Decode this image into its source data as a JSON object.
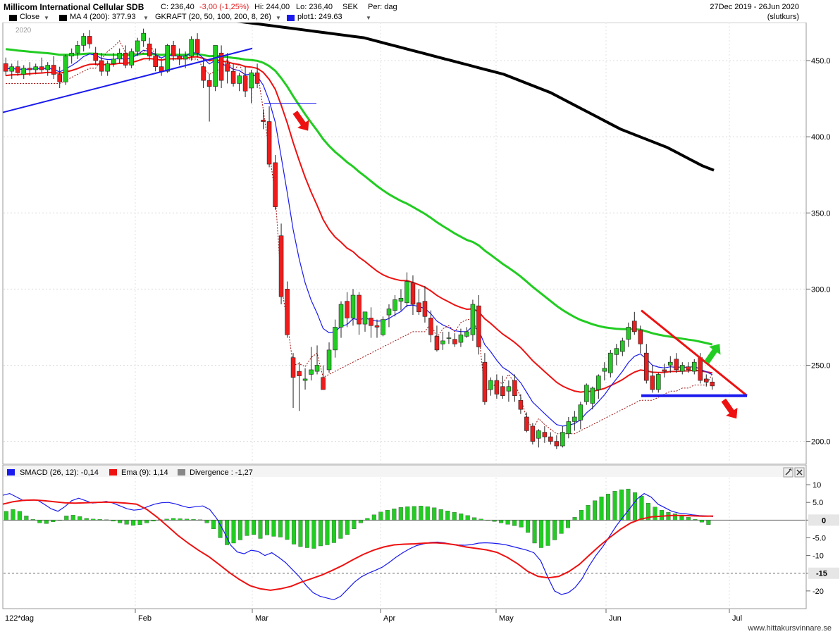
{
  "header": {
    "instrument": "Millicom International Cellular SDB",
    "close_label": "C: 236,40",
    "change": "-3,00 (-1,25%)",
    "hi": "Hi: 244,00",
    "lo": "Lo: 236,40",
    "currency": "SEK",
    "period": "Per: dag",
    "date_range": "27Dec 2019 - 26Jun 2020",
    "price_type": "(slutkurs)",
    "year_label": "2020"
  },
  "legend": {
    "close": "Close",
    "ma": "MA 4 (200): 377.93",
    "gkraft": "GKRAFT (20, 50, 100, 200, 8, 26)",
    "plot1": "plot1: 249.63"
  },
  "indicator_legend": {
    "smacd": "SMACD (26, 12): -0,14",
    "ema": "Ema (9): 1,14",
    "divergence": "Divergence : -1,27"
  },
  "footer": {
    "period_label": "122*dag",
    "watermark": "www.hittakursvinnare.se"
  },
  "colors": {
    "up": "#22cc22",
    "down": "#ee1c1c",
    "ma200": "#000000",
    "ma100": "#22cc22",
    "ma50": "#ee1111",
    "ma20": "#1a1aee",
    "macd": "#1a1aee",
    "signal": "#ee1111",
    "hist": "#22cc22"
  },
  "chart_data": [
    {
      "type": "candlestick",
      "title": "Millicom International Cellular SDB",
      "ylim": [
        185,
        475
      ],
      "y_ticks": [
        "450.0",
        "400.0",
        "350.0",
        "300.0",
        "250.0",
        "200.0"
      ],
      "x_ticks": [
        "Feb",
        "Mar",
        "Apr",
        "May",
        "Jun",
        "Jul"
      ],
      "current_value_label": "",
      "candles": [
        {
          "o": 448,
          "h": 452,
          "l": 440,
          "c": 443
        },
        {
          "o": 443,
          "h": 448,
          "l": 438,
          "c": 446
        },
        {
          "o": 446,
          "h": 450,
          "l": 440,
          "c": 442
        },
        {
          "o": 441,
          "h": 447,
          "l": 438,
          "c": 445
        },
        {
          "o": 445,
          "h": 449,
          "l": 440,
          "c": 444
        },
        {
          "o": 444,
          "h": 448,
          "l": 441,
          "c": 446
        },
        {
          "o": 446,
          "h": 452,
          "l": 442,
          "c": 444
        },
        {
          "o": 444,
          "h": 449,
          "l": 440,
          "c": 447
        },
        {
          "o": 447,
          "h": 453,
          "l": 438,
          "c": 441
        },
        {
          "o": 441,
          "h": 446,
          "l": 432,
          "c": 436
        },
        {
          "o": 436,
          "h": 454,
          "l": 434,
          "c": 453
        },
        {
          "o": 453,
          "h": 458,
          "l": 448,
          "c": 455
        },
        {
          "o": 455,
          "h": 463,
          "l": 451,
          "c": 460
        },
        {
          "o": 460,
          "h": 468,
          "l": 456,
          "c": 466
        },
        {
          "o": 466,
          "h": 470,
          "l": 458,
          "c": 461
        },
        {
          "o": 455,
          "h": 459,
          "l": 447,
          "c": 450
        },
        {
          "o": 450,
          "h": 455,
          "l": 440,
          "c": 443
        },
        {
          "o": 443,
          "h": 450,
          "l": 440,
          "c": 448
        },
        {
          "o": 448,
          "h": 455,
          "l": 446,
          "c": 451
        },
        {
          "o": 451,
          "h": 458,
          "l": 448,
          "c": 455
        },
        {
          "o": 455,
          "h": 460,
          "l": 445,
          "c": 447
        },
        {
          "o": 447,
          "h": 458,
          "l": 445,
          "c": 456
        },
        {
          "o": 456,
          "h": 465,
          "l": 453,
          "c": 463
        },
        {
          "o": 463,
          "h": 471,
          "l": 459,
          "c": 468
        },
        {
          "o": 461,
          "h": 465,
          "l": 450,
          "c": 453
        },
        {
          "o": 453,
          "h": 458,
          "l": 443,
          "c": 446
        },
        {
          "o": 446,
          "h": 450,
          "l": 440,
          "c": 443
        },
        {
          "o": 443,
          "h": 461,
          "l": 442,
          "c": 460
        },
        {
          "o": 460,
          "h": 463,
          "l": 450,
          "c": 453
        },
        {
          "o": 453,
          "h": 458,
          "l": 447,
          "c": 451
        },
        {
          "o": 451,
          "h": 456,
          "l": 445,
          "c": 453
        },
        {
          "o": 453,
          "h": 466,
          "l": 450,
          "c": 464
        },
        {
          "o": 464,
          "h": 468,
          "l": 452,
          "c": 455
        },
        {
          "o": 446,
          "h": 452,
          "l": 432,
          "c": 437
        },
        {
          "o": 437,
          "h": 441,
          "l": 410,
          "c": 433
        },
        {
          "o": 433,
          "h": 452,
          "l": 430,
          "c": 460
        },
        {
          "o": 455,
          "h": 460,
          "l": 432,
          "c": 437
        },
        {
          "o": 448,
          "h": 455,
          "l": 435,
          "c": 443
        },
        {
          "o": 443,
          "h": 448,
          "l": 433,
          "c": 435
        },
        {
          "o": 435,
          "h": 442,
          "l": 430,
          "c": 440
        },
        {
          "o": 440,
          "h": 446,
          "l": 426,
          "c": 430
        },
        {
          "o": 432,
          "h": 444,
          "l": 422,
          "c": 442
        },
        {
          "o": 442,
          "h": 448,
          "l": 432,
          "c": 435
        },
        {
          "o": 411,
          "h": 418,
          "l": 405,
          "c": 410
        },
        {
          "o": 410,
          "h": 420,
          "l": 380,
          "c": 382
        },
        {
          "o": 383,
          "h": 388,
          "l": 352,
          "c": 354
        },
        {
          "o": 335,
          "h": 343,
          "l": 290,
          "c": 295
        },
        {
          "o": 300,
          "h": 305,
          "l": 268,
          "c": 270
        },
        {
          "o": 255,
          "h": 258,
          "l": 222,
          "c": 242
        },
        {
          "o": 246,
          "h": 252,
          "l": 220,
          "c": 243
        },
        {
          "o": 240,
          "h": 248,
          "l": 234,
          "c": 241
        },
        {
          "o": 244,
          "h": 262,
          "l": 240,
          "c": 247
        },
        {
          "o": 246,
          "h": 263,
          "l": 244,
          "c": 250
        },
        {
          "o": 242,
          "h": 250,
          "l": 234,
          "c": 234
        },
        {
          "o": 247,
          "h": 265,
          "l": 245,
          "c": 260
        },
        {
          "o": 260,
          "h": 280,
          "l": 255,
          "c": 275
        },
        {
          "o": 275,
          "h": 292,
          "l": 268,
          "c": 290
        },
        {
          "o": 292,
          "h": 298,
          "l": 275,
          "c": 281
        },
        {
          "o": 281,
          "h": 300,
          "l": 276,
          "c": 296
        },
        {
          "o": 296,
          "h": 298,
          "l": 270,
          "c": 277
        },
        {
          "o": 277,
          "h": 284,
          "l": 272,
          "c": 285
        },
        {
          "o": 281,
          "h": 288,
          "l": 268,
          "c": 276
        },
        {
          "o": 276,
          "h": 280,
          "l": 268,
          "c": 275
        },
        {
          "o": 270,
          "h": 282,
          "l": 269,
          "c": 280
        },
        {
          "o": 283,
          "h": 290,
          "l": 275,
          "c": 287
        },
        {
          "o": 286,
          "h": 296,
          "l": 282,
          "c": 293
        },
        {
          "o": 292,
          "h": 300,
          "l": 286,
          "c": 294
        },
        {
          "o": 291,
          "h": 311,
          "l": 288,
          "c": 305
        },
        {
          "o": 304,
          "h": 309,
          "l": 283,
          "c": 290
        },
        {
          "o": 291,
          "h": 300,
          "l": 283,
          "c": 285
        },
        {
          "o": 292,
          "h": 302,
          "l": 278,
          "c": 282
        },
        {
          "o": 281,
          "h": 286,
          "l": 265,
          "c": 270
        },
        {
          "o": 269,
          "h": 276,
          "l": 259,
          "c": 260
        },
        {
          "o": 264,
          "h": 272,
          "l": 260,
          "c": 266
        },
        {
          "o": 268,
          "h": 272,
          "l": 264,
          "c": 268
        },
        {
          "o": 267,
          "h": 271,
          "l": 262,
          "c": 264
        },
        {
          "o": 265,
          "h": 274,
          "l": 262,
          "c": 270
        },
        {
          "o": 269,
          "h": 275,
          "l": 268,
          "c": 272
        },
        {
          "o": 270,
          "h": 293,
          "l": 266,
          "c": 290
        },
        {
          "o": 289,
          "h": 296,
          "l": 257,
          "c": 262
        },
        {
          "o": 252,
          "h": 258,
          "l": 224,
          "c": 226
        },
        {
          "o": 234,
          "h": 242,
          "l": 230,
          "c": 240
        },
        {
          "o": 240,
          "h": 244,
          "l": 228,
          "c": 231
        },
        {
          "o": 236,
          "h": 243,
          "l": 228,
          "c": 230
        },
        {
          "o": 233,
          "h": 240,
          "l": 226,
          "c": 236
        },
        {
          "o": 240,
          "h": 244,
          "l": 226,
          "c": 230
        },
        {
          "o": 227,
          "h": 231,
          "l": 218,
          "c": 221
        },
        {
          "o": 216,
          "h": 219,
          "l": 206,
          "c": 207
        },
        {
          "o": 210,
          "h": 212,
          "l": 198,
          "c": 200
        },
        {
          "o": 202,
          "h": 208,
          "l": 196,
          "c": 207
        },
        {
          "o": 206,
          "h": 210,
          "l": 199,
          "c": 203
        },
        {
          "o": 203,
          "h": 206,
          "l": 198,
          "c": 200
        },
        {
          "o": 200,
          "h": 204,
          "l": 195,
          "c": 197
        },
        {
          "o": 197,
          "h": 210,
          "l": 196,
          "c": 206
        },
        {
          "o": 205,
          "h": 216,
          "l": 202,
          "c": 213
        },
        {
          "o": 213,
          "h": 220,
          "l": 207,
          "c": 216
        },
        {
          "o": 214,
          "h": 226,
          "l": 208,
          "c": 224
        },
        {
          "o": 226,
          "h": 238,
          "l": 224,
          "c": 237
        },
        {
          "o": 225,
          "h": 236,
          "l": 221,
          "c": 235
        },
        {
          "o": 234,
          "h": 244,
          "l": 228,
          "c": 243
        },
        {
          "o": 246,
          "h": 252,
          "l": 240,
          "c": 248
        },
        {
          "o": 245,
          "h": 260,
          "l": 242,
          "c": 258
        },
        {
          "o": 257,
          "h": 264,
          "l": 250,
          "c": 261
        },
        {
          "o": 259,
          "h": 268,
          "l": 256,
          "c": 266
        },
        {
          "o": 267,
          "h": 278,
          "l": 262,
          "c": 275
        },
        {
          "o": 279,
          "h": 285,
          "l": 270,
          "c": 272
        },
        {
          "o": 273,
          "h": 276,
          "l": 258,
          "c": 264
        },
        {
          "o": 258,
          "h": 264,
          "l": 238,
          "c": 240
        },
        {
          "o": 243,
          "h": 250,
          "l": 232,
          "c": 234
        },
        {
          "o": 234,
          "h": 245,
          "l": 232,
          "c": 244
        },
        {
          "o": 247,
          "h": 251,
          "l": 242,
          "c": 246
        },
        {
          "o": 250,
          "h": 256,
          "l": 245,
          "c": 252
        },
        {
          "o": 254,
          "h": 258,
          "l": 245,
          "c": 247
        },
        {
          "o": 246,
          "h": 252,
          "l": 244,
          "c": 250
        },
        {
          "o": 249,
          "h": 252,
          "l": 245,
          "c": 247
        },
        {
          "o": 246,
          "h": 254,
          "l": 244,
          "c": 252
        },
        {
          "o": 255,
          "h": 258,
          "l": 238,
          "c": 240
        },
        {
          "o": 241,
          "h": 244,
          "l": 236,
          "c": 239
        },
        {
          "o": 239,
          "h": 242,
          "l": 234,
          "c": 236.4
        }
      ],
      "series": [
        {
          "name": "MA 4 (200)",
          "values": [
            482,
            481,
            480,
            479,
            478,
            477,
            476,
            475,
            474,
            473,
            472,
            471,
            470,
            469,
            468,
            467,
            466,
            465,
            463,
            461,
            459,
            457,
            455,
            453,
            451,
            449,
            447,
            445,
            443,
            441,
            438,
            435,
            432,
            429,
            425,
            421,
            417,
            413,
            409,
            405,
            402,
            399,
            396,
            393,
            389,
            385,
            381,
            378
          ]
        },
        {
          "name": "plot1",
          "values": [
            249.63
          ]
        }
      ],
      "annotations": []
    },
    {
      "type": "bar+line",
      "ylim": [
        -25,
        12
      ],
      "y_ticks": [
        "10",
        "5.0",
        "0",
        "-5.0",
        "-10",
        "-15",
        "-20"
      ],
      "zero_label": "0",
      "level_label": "-15",
      "series": [
        {
          "name": "SMACD (26, 12)",
          "values": [
            7,
            7.5,
            6.5,
            5.5,
            5.6,
            5.7,
            4.5,
            3.2,
            2.5,
            3.8,
            5.5,
            6.2,
            5.5,
            4.8,
            5.0,
            5.3,
            4.8,
            4.0,
            3.2,
            2.8,
            3.0,
            3.8,
            4.5,
            4.9,
            5.0,
            4.6,
            4.0,
            3.5,
            3.8,
            4.0,
            3.0,
            0.5,
            -3,
            -7,
            -9,
            -9.5,
            -8.5,
            -8.8,
            -10,
            -9.2,
            -10.5,
            -12,
            -14,
            -16,
            -18.5,
            -20.5,
            -21.5,
            -22,
            -22.5,
            -21.5,
            -19.5,
            -17.5,
            -16,
            -15,
            -14.2,
            -13.3,
            -12,
            -10.5,
            -9.2,
            -8.1,
            -7.2,
            -6.7,
            -6.3,
            -6.2,
            -6.4,
            -6.8,
            -7.0,
            -7.1,
            -6.9,
            -6.5,
            -6.4,
            -6.5,
            -6.7,
            -7.0,
            -7.5,
            -8.0,
            -8.5,
            -9.2,
            -11.5,
            -16,
            -20,
            -21,
            -20.5,
            -19,
            -16.5,
            -13,
            -10,
            -7.5,
            -4.5,
            -1.5,
            1.0,
            3.5,
            6.0,
            7.5,
            6.5,
            4.5,
            3.5,
            2.5,
            2.0,
            1.8,
            1.5,
            1.3,
            1.2,
            1.0
          ]
        },
        {
          "name": "Ema (9)",
          "values": [
            4.5,
            5.2,
            5.6,
            5.7,
            5.5,
            5.2,
            4.9,
            4.8,
            4.9,
            5.0,
            5.1,
            5.0,
            4.8,
            4.5,
            3.0,
            0.8,
            -1.7,
            -4.3,
            -6.5,
            -8.5,
            -10.3,
            -12.5,
            -14.8,
            -16.8,
            -18.5,
            -19.4,
            -19.8,
            -19.4,
            -18.7,
            -17.5,
            -16.5,
            -15.5,
            -14.2,
            -12.8,
            -11.2,
            -9.7,
            -8.5,
            -7.6,
            -7.0,
            -6.8,
            -6.7,
            -6.5,
            -6.4,
            -6.6,
            -7.0,
            -7.6,
            -8.0,
            -8.4,
            -9.1,
            -10.5,
            -12.3,
            -14.5,
            -15.9,
            -16.3,
            -15.9,
            -14.5,
            -12.5,
            -9.8,
            -7.2,
            -4.8,
            -2.6,
            -0.8,
            0.3,
            0.9,
            1.1,
            1.3,
            1.3,
            1.2,
            1.1,
            1.14
          ]
        },
        {
          "name": "Divergence",
          "values": [
            2.5,
            3.0,
            2.5,
            1.2,
            0.2,
            -0.8,
            -1,
            -0.5,
            0,
            1.2,
            1.4,
            1.0,
            0.5,
            0.3,
            0.2,
            0.1,
            -0.3,
            -0.8,
            -1.2,
            -1.5,
            -1.3,
            -0.8,
            -0.3,
            0.1,
            0.3,
            0.5,
            0.4,
            0.3,
            0.2,
            0.1,
            -0.8,
            -2.5,
            -5,
            -7,
            -6.5,
            -5.6,
            -4.4,
            -4.1,
            -5.2,
            -4.2,
            -4.6,
            -4.8,
            -5.5,
            -6.8,
            -7.5,
            -7.8,
            -8.0,
            -7.3,
            -7.0,
            -6.4,
            -5.2,
            -4.1,
            -2.5,
            -0.8,
            0.5,
            1.5,
            2.3,
            2.8,
            3.2,
            3.6,
            3.8,
            3.9,
            4.0,
            3.8,
            3.5,
            3.0,
            2.6,
            2.2,
            1.8,
            1.3,
            0.7,
            0.3,
            -0.1,
            -0.4,
            -0.8,
            -1.2,
            -1.6,
            -2.0,
            -3.5,
            -6.5,
            -7.8,
            -7.2,
            -5.6,
            -3.8,
            -2.2,
            0.8,
            2.8,
            4.2,
            5.5,
            6.6,
            7.4,
            8.2,
            8.6,
            8.8,
            7.8,
            6.8,
            4.8,
            3.7,
            2.8,
            2.2,
            1.8,
            1.3,
            0.8,
            0.2,
            -0.6,
            -1.27
          ]
        }
      ]
    }
  ]
}
